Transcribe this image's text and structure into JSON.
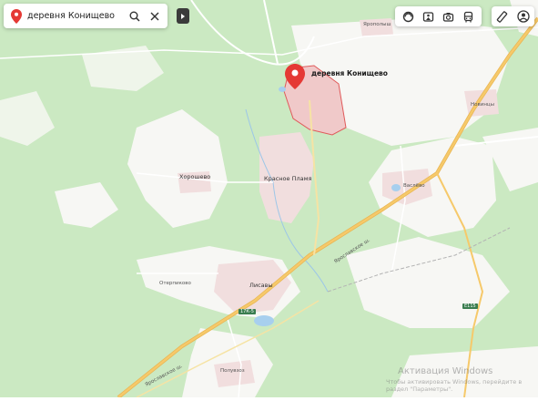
{
  "search": {
    "value": "деревня Конищево"
  },
  "marker": {
    "label": "деревня Конищево"
  },
  "places": [
    {
      "id": "yaropoltsy",
      "name": "Ярополыш"
    },
    {
      "id": "novinki",
      "name": "Новинцы"
    },
    {
      "id": "khoroshevo",
      "name": "Хорошево"
    },
    {
      "id": "krasnoe-plamya",
      "name": "Красное Пламя"
    },
    {
      "id": "vasilevo",
      "name": "Васлёво"
    },
    {
      "id": "lisavy",
      "name": "Лисавы"
    },
    {
      "id": "oterpikovo",
      "name": "Отерпиково"
    },
    {
      "id": "poluvaozy",
      "name": "Полувзоз"
    }
  ],
  "roads": {
    "yaroslavskoe_1": "Ярославское ш.",
    "yaroslavskoe_2": "Ярославское ш.",
    "shield_1": "17К-5",
    "shield_2": "Е115"
  },
  "watermark": {
    "title": "Активация Windows",
    "text": "Чтобы активировать Windows, перейдите в раздел \"Параметры\"."
  },
  "colors": {
    "forest": "#cbe9c2",
    "open_land": "#f7f7f4",
    "settlement": "#f1dede",
    "highlight_fill": "#f0c9c9",
    "highlight_border": "#e05a5a",
    "road_major": "#f6c96a",
    "water": "#a7cfee",
    "marker": "#e53935"
  },
  "icons": [
    "map-pin-icon",
    "search-icon",
    "close-icon",
    "collapse-arrow-icon",
    "layers-icon",
    "panorama-icon",
    "camera-icon",
    "transit-icon",
    "ruler-icon",
    "profile-icon"
  ]
}
